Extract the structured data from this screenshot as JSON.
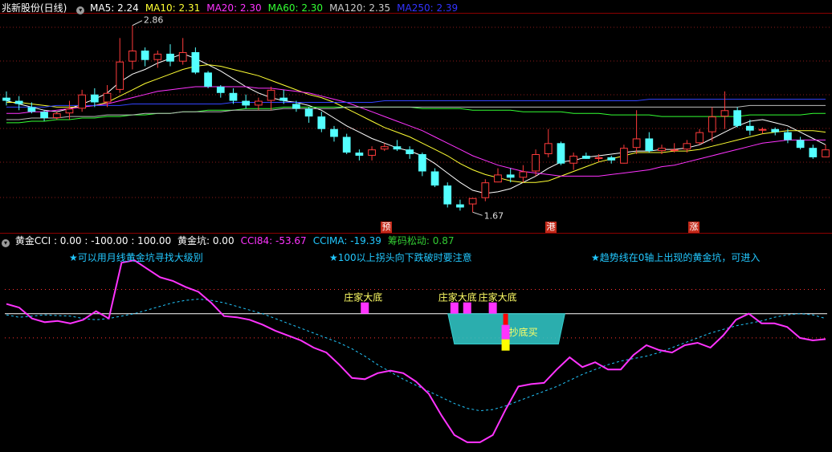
{
  "price_panel": {
    "title": "兆新股份(日线)",
    "ma_labels": [
      {
        "label": "MA5: 2.24",
        "color": "#ffffff"
      },
      {
        "label": "MA10: 2.31",
        "color": "#ffff33"
      },
      {
        "label": "MA20: 2.30",
        "color": "#ff33ff"
      },
      {
        "label": "MA60: 2.30",
        "color": "#33ff33"
      },
      {
        "label": "MA120: 2.35",
        "color": "#cccccc"
      },
      {
        "label": "MA250: 2.39",
        "color": "#3333ff"
      }
    ],
    "high_label": "2.86",
    "low_label": "1.67",
    "tags": [
      "预",
      "港",
      "涨"
    ]
  },
  "indicator_panel": {
    "title": "黄金CCI : 0.00 : -100.00 : 100.00",
    "values": [
      {
        "label": "黄金坑: 0.00",
        "color": "#ffffff"
      },
      {
        "label": "CCI84: -53.67",
        "color": "#ff33ff"
      },
      {
        "label": "CCIMA: -19.39",
        "color": "#22c8ff"
      },
      {
        "label": "筹码松动: 0.87",
        "color": "#33cc33"
      }
    ],
    "notes": [
      "★可以用月线黄金坑寻找大级别",
      "★100以上拐头向下跌破时要注意",
      "★趋势线在0轴上出现的黄金坑，可进入"
    ],
    "markers": [
      "庄家大底",
      "庄家大底",
      "庄家大底"
    ],
    "buy_label": "抄底买"
  },
  "chart_data": [
    {
      "type": "candlestick",
      "title": "兆新股份(日线)",
      "ohlc": [
        [
          2.4,
          2.44,
          2.35,
          2.38
        ],
        [
          2.38,
          2.41,
          2.32,
          2.36
        ],
        [
          2.34,
          2.37,
          2.3,
          2.31
        ],
        [
          2.31,
          2.32,
          2.25,
          2.27
        ],
        [
          2.27,
          2.31,
          2.26,
          2.3
        ],
        [
          2.3,
          2.38,
          2.26,
          2.33
        ],
        [
          2.33,
          2.45,
          2.31,
          2.42
        ],
        [
          2.42,
          2.46,
          2.34,
          2.37
        ],
        [
          2.37,
          2.48,
          2.34,
          2.43
        ],
        [
          2.45,
          2.78,
          2.43,
          2.63
        ],
        [
          2.63,
          2.86,
          2.58,
          2.7
        ],
        [
          2.7,
          2.72,
          2.6,
          2.64
        ],
        [
          2.64,
          2.7,
          2.59,
          2.68
        ],
        [
          2.68,
          2.74,
          2.6,
          2.63
        ],
        [
          2.63,
          2.78,
          2.61,
          2.69
        ],
        [
          2.69,
          2.72,
          2.55,
          2.56
        ],
        [
          2.56,
          2.57,
          2.46,
          2.47
        ],
        [
          2.47,
          2.48,
          2.4,
          2.43
        ],
        [
          2.43,
          2.46,
          2.36,
          2.38
        ],
        [
          2.38,
          2.42,
          2.33,
          2.35
        ],
        [
          2.35,
          2.4,
          2.32,
          2.38
        ],
        [
          2.38,
          2.47,
          2.32,
          2.45
        ],
        [
          2.4,
          2.45,
          2.36,
          2.38
        ],
        [
          2.36,
          2.38,
          2.31,
          2.33
        ],
        [
          2.33,
          2.34,
          2.24,
          2.28
        ],
        [
          2.28,
          2.31,
          2.18,
          2.2
        ],
        [
          2.2,
          2.22,
          2.12,
          2.15
        ],
        [
          2.15,
          2.17,
          2.04,
          2.05
        ],
        [
          2.05,
          2.07,
          2.0,
          2.03
        ],
        [
          2.03,
          2.09,
          2.0,
          2.07
        ],
        [
          2.07,
          2.11,
          2.06,
          2.09
        ],
        [
          2.09,
          2.13,
          2.06,
          2.07
        ],
        [
          2.07,
          2.09,
          2.01,
          2.04
        ],
        [
          2.04,
          2.05,
          1.9,
          1.93
        ],
        [
          1.93,
          1.95,
          1.83,
          1.84
        ],
        [
          1.84,
          1.86,
          1.7,
          1.72
        ],
        [
          1.72,
          1.75,
          1.68,
          1.7
        ],
        [
          1.72,
          1.76,
          1.67,
          1.76
        ],
        [
          1.76,
          1.88,
          1.74,
          1.86
        ],
        [
          1.86,
          1.95,
          1.86,
          1.91
        ],
        [
          1.91,
          1.95,
          1.86,
          1.89
        ],
        [
          1.89,
          1.97,
          1.86,
          1.93
        ],
        [
          1.93,
          2.07,
          1.9,
          2.04
        ],
        [
          2.04,
          2.2,
          2.02,
          2.11
        ],
        [
          2.11,
          2.12,
          1.97,
          1.98
        ],
        [
          1.98,
          2.05,
          1.94,
          2.03
        ],
        [
          2.03,
          2.05,
          2.01,
          2.01
        ],
        [
          2.01,
          2.04,
          1.99,
          2.02
        ],
        [
          2.02,
          2.03,
          1.98,
          2.0
        ],
        [
          1.98,
          2.1,
          1.98,
          2.08
        ],
        [
          2.08,
          2.32,
          2.04,
          2.14
        ],
        [
          2.14,
          2.18,
          2.05,
          2.06
        ],
        [
          2.06,
          2.1,
          2.04,
          2.08
        ],
        [
          2.06,
          2.11,
          2.05,
          2.07
        ],
        [
          2.07,
          2.13,
          2.05,
          2.11
        ],
        [
          2.11,
          2.2,
          2.1,
          2.18
        ],
        [
          2.18,
          2.34,
          2.12,
          2.28
        ],
        [
          2.28,
          2.44,
          2.2,
          2.32
        ],
        [
          2.32,
          2.34,
          2.21,
          2.22
        ],
        [
          2.22,
          2.26,
          2.16,
          2.19
        ],
        [
          2.19,
          2.21,
          2.17,
          2.2
        ],
        [
          2.2,
          2.21,
          2.16,
          2.18
        ],
        [
          2.18,
          2.2,
          2.11,
          2.13
        ],
        [
          2.13,
          2.15,
          2.07,
          2.08
        ],
        [
          2.08,
          2.1,
          2.01,
          2.02
        ],
        [
          2.02,
          2.1,
          2.02,
          2.07
        ]
      ],
      "series": [
        {
          "name": "MA5",
          "values": [
            2.38,
            2.36,
            2.34,
            2.32,
            2.31,
            2.33,
            2.36,
            2.39,
            2.43,
            2.5,
            2.55,
            2.58,
            2.62,
            2.65,
            2.68,
            2.65,
            2.61,
            2.57,
            2.52,
            2.47,
            2.43,
            2.4,
            2.38,
            2.37,
            2.35,
            2.32,
            2.27,
            2.22,
            2.18,
            2.14,
            2.11,
            2.08,
            2.06,
            2.03,
            1.98,
            1.92,
            1.86,
            1.81,
            1.79,
            1.8,
            1.82,
            1.86,
            1.9,
            1.95,
            1.99,
            2.0,
            2.02,
            2.03,
            2.04,
            2.05,
            2.06,
            2.06,
            2.07,
            2.07,
            2.08,
            2.1,
            2.14,
            2.18,
            2.22,
            2.25,
            2.26,
            2.24,
            2.22,
            2.18,
            2.14,
            2.1
          ]
        },
        {
          "name": "MA10",
          "values": [
            2.37,
            2.37,
            2.36,
            2.35,
            2.34,
            2.34,
            2.34,
            2.35,
            2.37,
            2.41,
            2.45,
            2.49,
            2.52,
            2.55,
            2.58,
            2.6,
            2.61,
            2.6,
            2.58,
            2.56,
            2.54,
            2.51,
            2.48,
            2.45,
            2.42,
            2.4,
            2.37,
            2.33,
            2.29,
            2.25,
            2.21,
            2.18,
            2.15,
            2.11,
            2.07,
            2.03,
            1.98,
            1.94,
            1.91,
            1.89,
            1.87,
            1.86,
            1.86,
            1.87,
            1.9,
            1.93,
            1.96,
            1.99,
            2.01,
            2.03,
            2.05,
            2.05,
            2.05,
            2.06,
            2.06,
            2.07,
            2.09,
            2.11,
            2.13,
            2.15,
            2.17,
            2.18,
            2.19,
            2.19,
            2.19,
            2.18
          ]
        },
        {
          "name": "MA20",
          "values": [
            2.3,
            2.3,
            2.31,
            2.31,
            2.32,
            2.33,
            2.34,
            2.35,
            2.36,
            2.38,
            2.4,
            2.42,
            2.44,
            2.45,
            2.46,
            2.47,
            2.47,
            2.47,
            2.47,
            2.47,
            2.46,
            2.46,
            2.45,
            2.44,
            2.43,
            2.41,
            2.39,
            2.37,
            2.34,
            2.31,
            2.28,
            2.25,
            2.22,
            2.19,
            2.15,
            2.11,
            2.07,
            2.03,
            2.0,
            1.97,
            1.95,
            1.93,
            1.92,
            1.91,
            1.9,
            1.9,
            1.9,
            1.9,
            1.91,
            1.92,
            1.93,
            1.94,
            1.96,
            1.97,
            1.99,
            2.01,
            2.03,
            2.05,
            2.07,
            2.09,
            2.11,
            2.12,
            2.13,
            2.13,
            2.13,
            2.13
          ]
        },
        {
          "name": "MA60",
          "values": [
            2.24,
            2.24,
            2.25,
            2.25,
            2.26,
            2.26,
            2.27,
            2.27,
            2.28,
            2.28,
            2.29,
            2.29,
            2.3,
            2.3,
            2.31,
            2.31,
            2.32,
            2.32,
            2.32,
            2.33,
            2.33,
            2.33,
            2.34,
            2.34,
            2.34,
            2.34,
            2.34,
            2.34,
            2.34,
            2.34,
            2.34,
            2.34,
            2.34,
            2.33,
            2.33,
            2.33,
            2.33,
            2.32,
            2.32,
            2.32,
            2.32,
            2.31,
            2.31,
            2.31,
            2.31,
            2.3,
            2.3,
            2.3,
            2.29,
            2.29,
            2.29,
            2.29,
            2.28,
            2.28,
            2.28,
            2.28,
            2.28,
            2.28,
            2.28,
            2.29,
            2.29,
            2.29,
            2.29,
            2.29,
            2.3,
            2.3
          ]
        },
        {
          "name": "MA120",
          "values": [
            2.26,
            2.26,
            2.27,
            2.27,
            2.27,
            2.28,
            2.28,
            2.28,
            2.29,
            2.29,
            2.29,
            2.3,
            2.3,
            2.3,
            2.31,
            2.31,
            2.31,
            2.31,
            2.32,
            2.32,
            2.32,
            2.32,
            2.33,
            2.33,
            2.33,
            2.33,
            2.33,
            2.34,
            2.34,
            2.34,
            2.34,
            2.34,
            2.34,
            2.34,
            2.34,
            2.34,
            2.34,
            2.34,
            2.34,
            2.34,
            2.34,
            2.34,
            2.34,
            2.34,
            2.34,
            2.34,
            2.34,
            2.34,
            2.34,
            2.34,
            2.34,
            2.34,
            2.34,
            2.34,
            2.34,
            2.34,
            2.34,
            2.34,
            2.34,
            2.35,
            2.35,
            2.35,
            2.35,
            2.35,
            2.35,
            2.35
          ]
        },
        {
          "name": "MA250",
          "values": [
            2.34,
            2.34,
            2.34,
            2.34,
            2.35,
            2.35,
            2.35,
            2.35,
            2.35,
            2.35,
            2.36,
            2.36,
            2.36,
            2.36,
            2.36,
            2.36,
            2.36,
            2.36,
            2.37,
            2.37,
            2.37,
            2.37,
            2.37,
            2.37,
            2.37,
            2.37,
            2.37,
            2.37,
            2.37,
            2.37,
            2.38,
            2.38,
            2.38,
            2.38,
            2.38,
            2.38,
            2.38,
            2.38,
            2.38,
            2.38,
            2.38,
            2.38,
            2.38,
            2.38,
            2.38,
            2.38,
            2.38,
            2.38,
            2.38,
            2.38,
            2.38,
            2.39,
            2.39,
            2.39,
            2.39,
            2.39,
            2.39,
            2.39,
            2.39,
            2.39,
            2.39,
            2.39,
            2.39,
            2.39,
            2.39,
            2.39
          ]
        }
      ],
      "ylim": [
        1.6,
        2.92
      ]
    },
    {
      "type": "line",
      "title": "黄金CCI",
      "series": [
        {
          "name": "CCI84",
          "values": [
            40,
            25,
            -20,
            -35,
            -30,
            -40,
            -25,
            10,
            -20,
            210,
            220,
            185,
            150,
            135,
            110,
            90,
            45,
            -10,
            -15,
            -25,
            -45,
            -70,
            -90,
            -110,
            -140,
            -160,
            -210,
            -265,
            -270,
            -245,
            -235,
            -245,
            -280,
            -330,
            -420,
            -500,
            -530,
            -530,
            -500,
            -395,
            -300,
            -290,
            -285,
            -230,
            -180,
            -220,
            -200,
            -230,
            -230,
            -170,
            -130,
            -150,
            -160,
            -130,
            -120,
            -140,
            -90,
            -25,
            0,
            -40,
            -40,
            -55,
            -100,
            -110,
            -105
          ]
        },
        {
          "name": "CCIMA",
          "values": [
            -5,
            -15,
            -10,
            -5,
            -8,
            -10,
            -20,
            -25,
            -20,
            -10,
            0,
            15,
            30,
            45,
            55,
            60,
            55,
            45,
            30,
            15,
            0,
            -20,
            -40,
            -60,
            -80,
            -100,
            -120,
            -145,
            -175,
            -210,
            -240,
            -270,
            -295,
            -320,
            -345,
            -370,
            -390,
            -400,
            -395,
            -380,
            -360,
            -340,
            -320,
            -300,
            -275,
            -250,
            -230,
            -210,
            -195,
            -185,
            -175,
            -160,
            -140,
            -120,
            -100,
            -80,
            -65,
            -50,
            -40,
            -30,
            -15,
            -5,
            0,
            -5,
            -20
          ]
        }
      ],
      "reference_lines": [
        100,
        0,
        -100
      ],
      "ylim": [
        -560,
        300
      ]
    }
  ]
}
